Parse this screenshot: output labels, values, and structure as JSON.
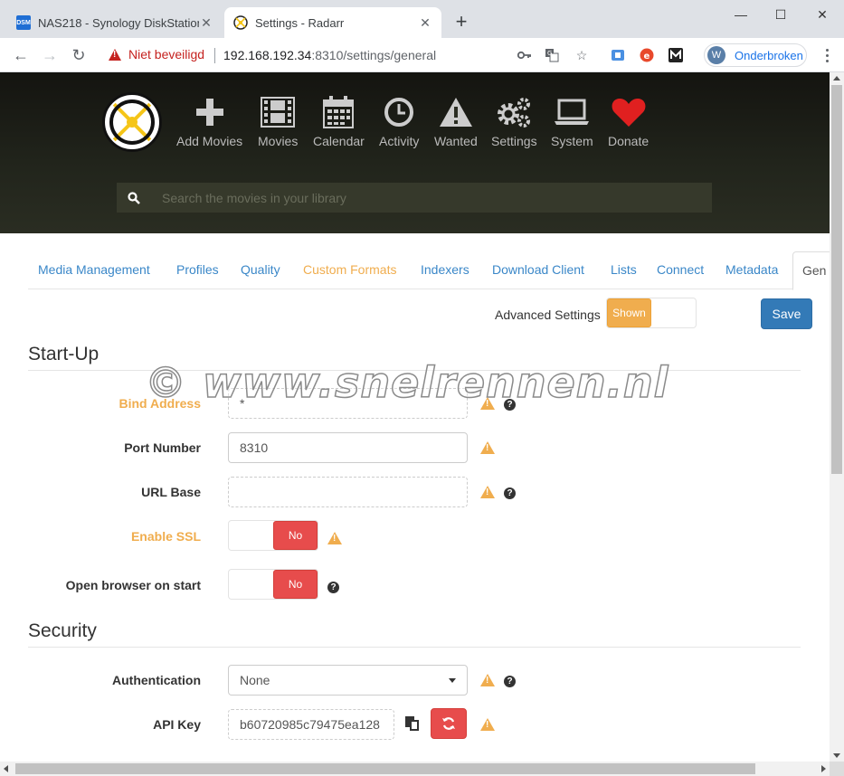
{
  "browser": {
    "tabs": [
      {
        "title": "NAS218 - Synology DiskStation",
        "favicon": "dsm-icon",
        "favicon_text": "DSM",
        "active": false
      },
      {
        "title": "Settings - Radarr",
        "favicon": "radarr-icon",
        "active": true
      }
    ],
    "security_label": "Niet beveiligd",
    "url_host": "192.168.192.34",
    "url_rest": ":8310/settings/general",
    "profile_initial": "W",
    "profile_label": "Onderbroken"
  },
  "header": {
    "nav": [
      {
        "label": "Add Movies",
        "icon": "plus-icon"
      },
      {
        "label": "Movies",
        "icon": "film-icon"
      },
      {
        "label": "Calendar",
        "icon": "calendar-icon"
      },
      {
        "label": "Activity",
        "icon": "clock-icon"
      },
      {
        "label": "Wanted",
        "icon": "warning-icon"
      },
      {
        "label": "Settings",
        "icon": "cogs-icon"
      },
      {
        "label": "System",
        "icon": "laptop-icon"
      },
      {
        "label": "Donate",
        "icon": "heart-icon"
      }
    ],
    "search_placeholder": "Search the movies in your library"
  },
  "subnav": {
    "items": [
      {
        "label": "Media Management"
      },
      {
        "label": "Profiles"
      },
      {
        "label": "Quality"
      },
      {
        "label": "Custom Formats",
        "warn": true
      },
      {
        "label": "Indexers"
      },
      {
        "label": "Download Client"
      },
      {
        "label": "Lists"
      },
      {
        "label": "Connect"
      },
      {
        "label": "Metadata"
      },
      {
        "label": "Gen",
        "active": true
      }
    ]
  },
  "toolbar": {
    "advanced_label": "Advanced Settings",
    "advanced_state": "Shown",
    "save_label": "Save"
  },
  "startup": {
    "legend": "Start-Up",
    "bind_address_label": "Bind Address",
    "bind_address_value": "*",
    "port_label": "Port Number",
    "port_value": "8310",
    "url_base_label": "URL Base",
    "url_base_value": "",
    "ssl_label": "Enable SSL",
    "ssl_value": "No",
    "open_browser_label": "Open browser on start",
    "open_browser_value": "No"
  },
  "security": {
    "legend": "Security",
    "auth_label": "Authentication",
    "auth_value": "None",
    "api_key_label": "API Key",
    "api_key_value": "b60720985c79475ea128"
  },
  "watermark": "© www.snelrennen.nl",
  "colors": {
    "warning": "#f0ad4e",
    "danger": "#e74c4c",
    "primary": "#337ab7",
    "link": "#3a87c8"
  }
}
